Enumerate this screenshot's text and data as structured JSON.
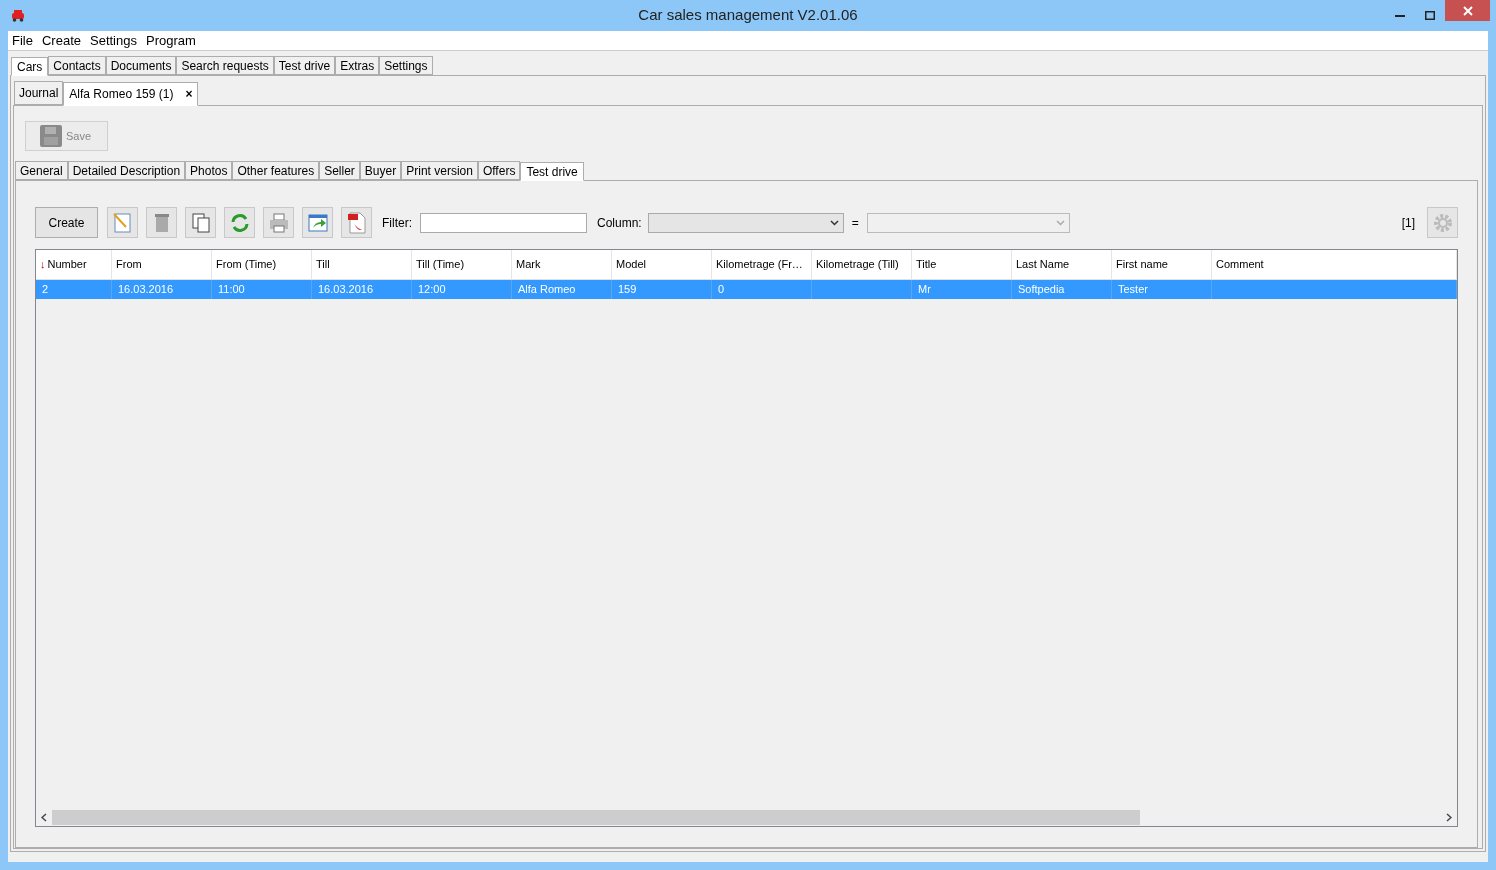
{
  "window": {
    "title": "Car sales management V2.01.06"
  },
  "menu": [
    "File",
    "Create",
    "Settings",
    "Program"
  ],
  "main_tabs": [
    {
      "label": "Cars",
      "selected": true
    },
    {
      "label": "Contacts",
      "selected": false
    },
    {
      "label": "Documents",
      "selected": false
    },
    {
      "label": "Search requests",
      "selected": false
    },
    {
      "label": "Test drive",
      "selected": false
    },
    {
      "label": "Extras",
      "selected": false
    },
    {
      "label": "Settings",
      "selected": false
    }
  ],
  "doc_tabs": [
    {
      "label": "Journal",
      "selected": false
    },
    {
      "label": "Alfa Romeo 159 (1)",
      "selected": true,
      "close": "×"
    }
  ],
  "save_button": {
    "label": "Save",
    "disabled": true
  },
  "detail_tabs": [
    {
      "label": "General",
      "selected": false
    },
    {
      "label": "Detailed Description",
      "selected": false
    },
    {
      "label": "Photos",
      "selected": false
    },
    {
      "label": "Other features",
      "selected": false
    },
    {
      "label": "Seller",
      "selected": false
    },
    {
      "label": "Buyer",
      "selected": false
    },
    {
      "label": "Print version",
      "selected": false
    },
    {
      "label": "Offers",
      "selected": false
    },
    {
      "label": "Test drive",
      "selected": true
    }
  ],
  "toolbar": {
    "create": "Create",
    "filter_label": "Filter:",
    "column_label": "Column:",
    "equals": "=",
    "count": "[1]"
  },
  "table": {
    "sort_arrow": "↓",
    "columns": [
      "Number",
      "From",
      "From (Time)",
      "Till",
      "Till (Time)",
      "Mark",
      "Model",
      "Kilometrage (Fr…",
      "Kilometrage (Till)",
      "Title",
      "Last Name",
      "First name",
      "Comment"
    ],
    "rows": [
      {
        "selected": true,
        "cells": [
          "2",
          "16.03.2016",
          "11:00",
          "16.03.2016",
          "12:00",
          "Alfa Romeo",
          "159",
          "0",
          "",
          "Mr",
          "Softpedia",
          "Tester",
          ""
        ]
      }
    ]
  }
}
